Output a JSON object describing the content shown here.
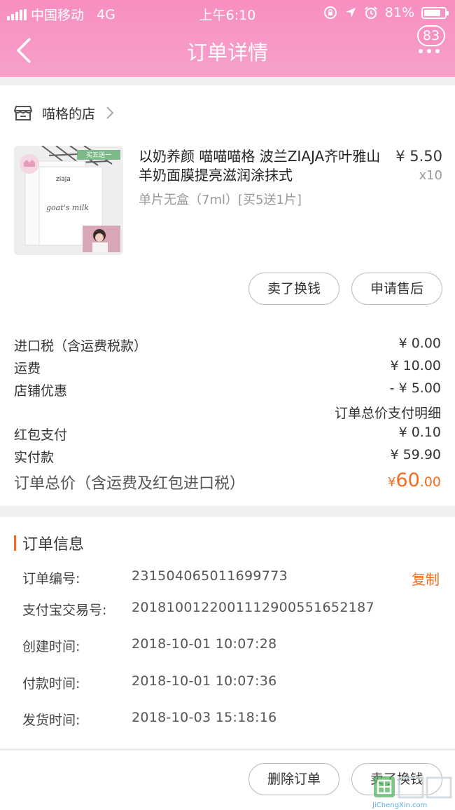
{
  "status_bar": {
    "carrier": "中国移动",
    "network": "4G",
    "time": "上午6:10",
    "battery": "81%",
    "battery_level": 0.81
  },
  "nav": {
    "title": "订单详情",
    "badge_count": "83"
  },
  "shop": {
    "name": "喵格的店"
  },
  "product": {
    "title": "以奶养颜 喵喵喵格 波兰ZIAJA齐叶雅山羊奶面膜提亮滋润涂抹式",
    "spec": "单片无盒（7ml）[买5送1片]",
    "price": "¥ 5.50",
    "quantity": "x10",
    "image_tag": "买五送一",
    "image_product_text": "goat's milk",
    "image_brand_text": "ziaja"
  },
  "actions": {
    "sell_button": "卖了换钱",
    "after_sale_button": "申请售后",
    "delete_button": "删除订单",
    "bottom_sell_button": "卖了换钱"
  },
  "fees": [
    {
      "label": "进口税（含运费税款）",
      "value": "¥ 0.00"
    },
    {
      "label": "运费",
      "value": "¥ 10.00"
    },
    {
      "label": "店铺优惠",
      "value": "- ¥ 5.00"
    }
  ],
  "payment_detail_link": "订单总价支付明细",
  "payments": [
    {
      "label": "红包支付",
      "value": "¥ 0.10"
    },
    {
      "label": "实付款",
      "value": "¥ 59.90"
    }
  ],
  "total": {
    "label": "订单总价（含运费及红包进口税）",
    "symbol": "¥",
    "integer": "60",
    "decimal": ".00"
  },
  "order_info": {
    "title": "订单信息",
    "copy_label": "复制",
    "rows": [
      {
        "label": "订单编号:",
        "value": "231504065011699773"
      },
      {
        "label": "支付宝交易号:",
        "value": "2018100122001112900551652187"
      },
      {
        "label": "创建时间:",
        "value": "2018-10-01 10:07:28"
      },
      {
        "label": "付款时间:",
        "value": "2018-10-01 10:07:36"
      },
      {
        "label": "发货时间:",
        "value": "2018-10-03 15:18:16"
      }
    ]
  },
  "watermark": {
    "text": "JiChengXin.com"
  },
  "colors": {
    "header_pink": "#f78fc0",
    "accent_orange": "#f56a1f"
  }
}
